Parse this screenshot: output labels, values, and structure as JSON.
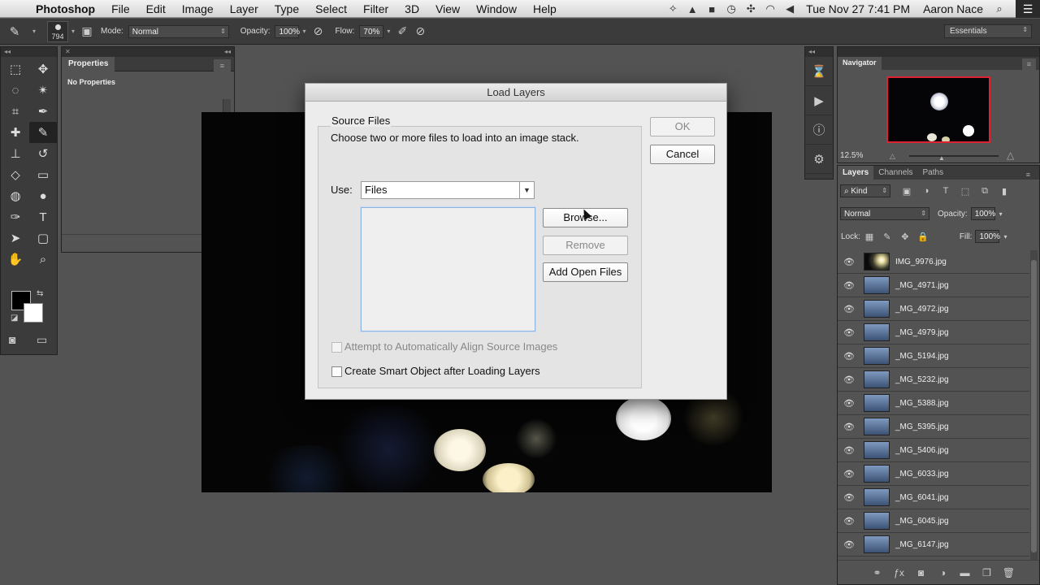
{
  "menubar": {
    "app_name": "Photoshop",
    "items": [
      "File",
      "Edit",
      "Image",
      "Layer",
      "Type",
      "Select",
      "Filter",
      "3D",
      "View",
      "Window",
      "Help"
    ],
    "clock": "Tue Nov 27  7:41 PM",
    "user": "Aaron Nace"
  },
  "options_bar": {
    "brush_size": "794",
    "mode_label": "Mode:",
    "mode_value": "Normal",
    "opacity_label": "Opacity:",
    "opacity_value": "100%",
    "flow_label": "Flow:",
    "flow_value": "70%",
    "workspace": "Essentials"
  },
  "properties_panel": {
    "title": "Properties",
    "empty_text": "No Properties"
  },
  "navigator_panel": {
    "title": "Navigator",
    "zoom": "12.5%"
  },
  "layers_panel": {
    "tabs": [
      "Layers",
      "Channels",
      "Paths"
    ],
    "filter_kind": "Kind",
    "blend_mode": "Normal",
    "opacity_label": "Opacity:",
    "opacity_value": "100%",
    "lock_label": "Lock:",
    "fill_label": "Fill:",
    "fill_value": "100%",
    "layers": [
      "IMG_9976.jpg",
      "_MG_4971.jpg",
      "_MG_4972.jpg",
      "_MG_4979.jpg",
      "_MG_5194.jpg",
      "_MG_5232.jpg",
      "_MG_5388.jpg",
      "_MG_5395.jpg",
      "_MG_5406.jpg",
      "_MG_6033.jpg",
      "_MG_6041.jpg",
      "_MG_6045.jpg",
      "_MG_6147.jpg"
    ]
  },
  "dialog": {
    "title": "Load Layers",
    "group_label": "Source Files",
    "description": "Choose two or more files to load into an image stack.",
    "use_label": "Use:",
    "use_value": "Files",
    "ok_label": "OK",
    "cancel_label": "Cancel",
    "browse_label": "Browse...",
    "remove_label": "Remove",
    "add_open_files_label": "Add Open Files",
    "align_label": "Attempt to Automatically Align Source Images",
    "smart_object_label": "Create Smart Object after Loading Layers"
  },
  "colors": {
    "foreground": "#000000",
    "background": "#ffffff",
    "navigator_frame": "#dd2233"
  }
}
